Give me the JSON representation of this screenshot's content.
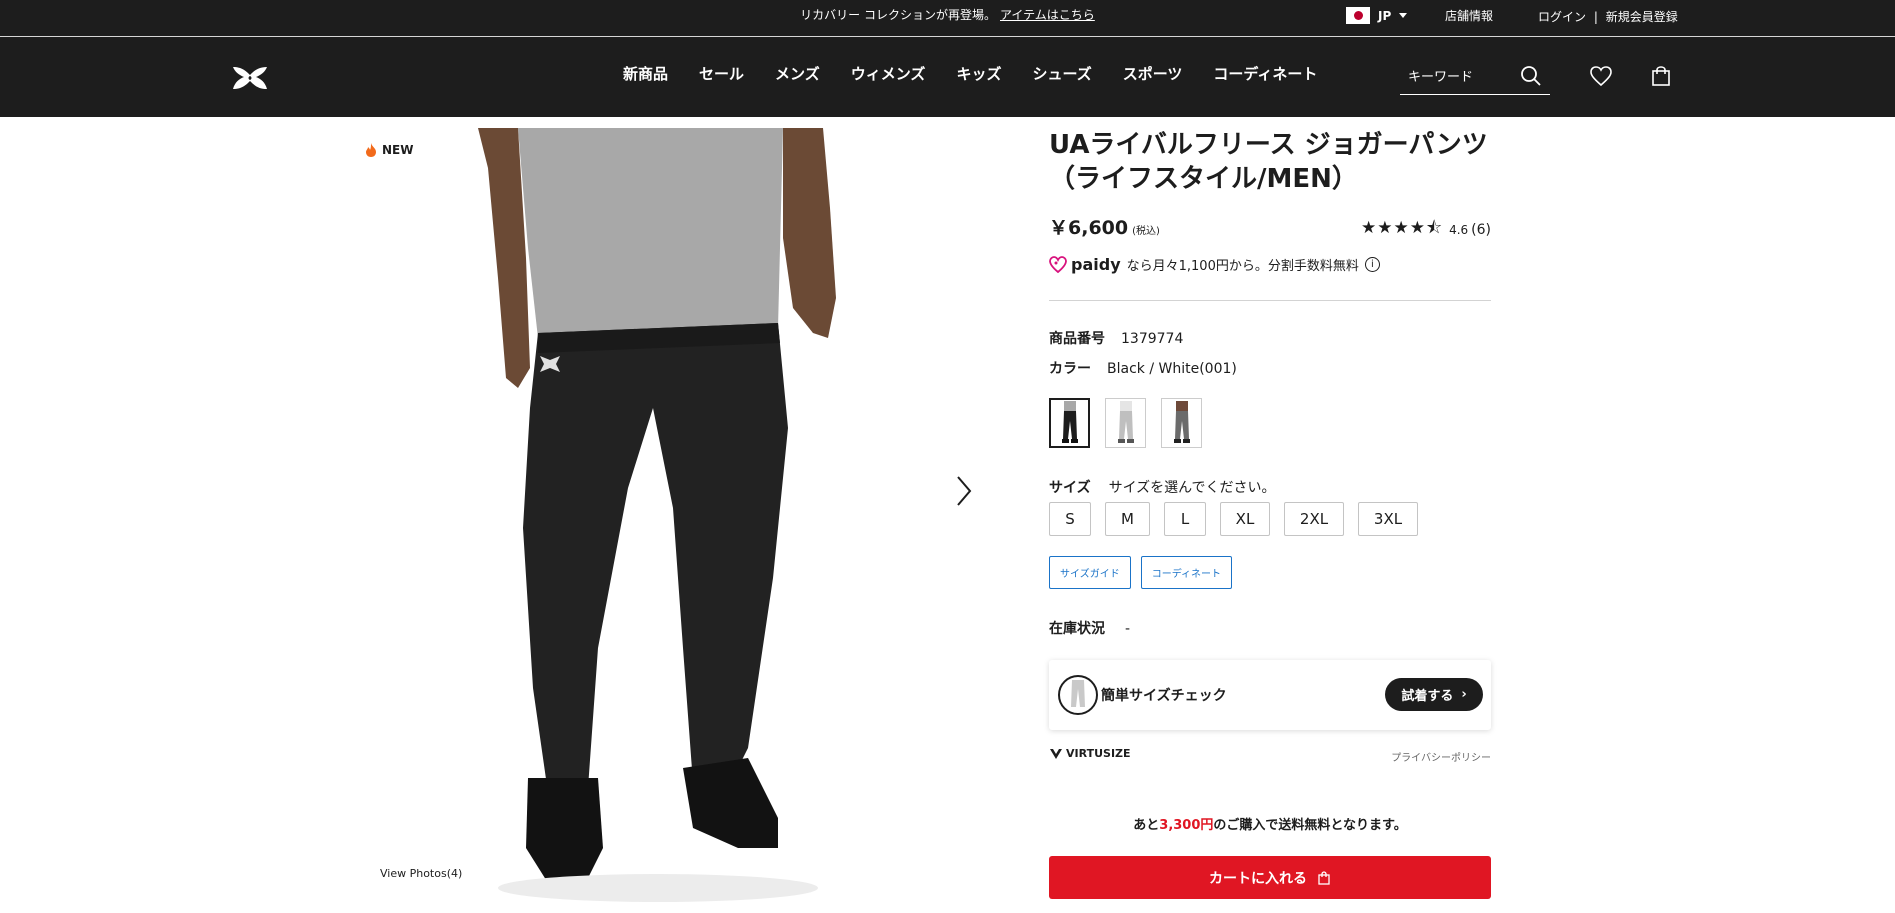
{
  "announcement": {
    "text": "リカバリー コレクションが再登場。",
    "link": "アイテムはこちら"
  },
  "utility": {
    "country": "JP",
    "stores": "店舗情報",
    "login": "ログイン",
    "separator": "|",
    "register": "新規会員登録"
  },
  "nav": {
    "items": [
      "新商品",
      "セール",
      "メンズ",
      "ウィメンズ",
      "キッズ",
      "シューズ",
      "スポーツ",
      "コーディネート"
    ],
    "search_placeholder": "キーワード"
  },
  "gallery": {
    "badge": "NEW",
    "view_photos": "View Photos(4)"
  },
  "product": {
    "title": "UAライバルフリース ジョガーパンツ（ライフスタイル/MEN）",
    "price": "￥6,600",
    "tax_note": "(税込)",
    "rating_value": "4.6",
    "rating_count": "(6)",
    "rating_stars": 4.6,
    "paidy_logo": "paidy",
    "paidy_text": "なら月々1,100円から。分割手数料無料",
    "product_no_label": "商品番号",
    "product_no": "1379774",
    "color_label": "カラー",
    "color_value": "Black / White(001)",
    "swatches": [
      {
        "color": "#1d1d1d",
        "selected": true
      },
      {
        "color": "#bfbfbf",
        "selected": false
      },
      {
        "color": "#6b6b6b",
        "selected": false
      }
    ],
    "size_label": "サイズ",
    "size_prompt": "サイズを選んでください。",
    "sizes": [
      "S",
      "M",
      "L",
      "XL",
      "2XL",
      "3XL"
    ],
    "size_guide": "サイズガイド",
    "coordinate": "コーディネート",
    "stock_label": "在庫状況",
    "stock_value": "-",
    "virtusize_label": "簡単サイズチェック",
    "virtusize_try": "試着する",
    "virtusize_brand": "VIRTUSIZE",
    "privacy": "プライバシーポリシー",
    "ship_prefix": "あと",
    "ship_amount": "3,300円",
    "ship_suffix": "のご購入で送料無料となります。",
    "cart_button": "カートに入れる"
  },
  "colors": {
    "header_bg": "#1d1d1d",
    "accent_red": "#e01623",
    "link_blue": "#1a73c8"
  }
}
